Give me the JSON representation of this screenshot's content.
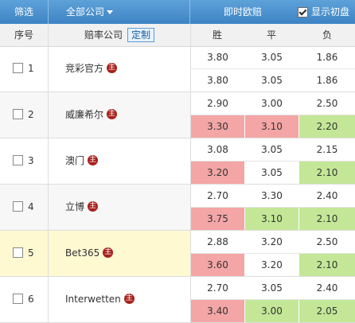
{
  "header": {
    "filter_label": "筛选",
    "company_label": "全部公司",
    "live_label": "即时欧赔",
    "show_initial_label": "显示初盘"
  },
  "subheader": {
    "seq_label": "序号",
    "odds_company_label": "赔率公司",
    "custom_button": "定制",
    "win_label": "胜",
    "draw_label": "平",
    "lose_label": "负"
  },
  "zhu_mark": "主",
  "colors": {
    "up": "#f4a5a5",
    "down": "#c3e796",
    "highlight_row": "#fff9d2"
  },
  "rows": [
    {
      "seq": "1",
      "company": "竞彩官方",
      "initial": [
        "3.80",
        "3.05",
        "1.86"
      ],
      "live": [
        "3.80",
        "3.05",
        "1.86"
      ],
      "live_trend": [
        "",
        "",
        ""
      ]
    },
    {
      "seq": "2",
      "company": "威廉希尔",
      "initial": [
        "2.90",
        "3.00",
        "2.50"
      ],
      "live": [
        "3.30",
        "3.10",
        "2.20"
      ],
      "live_trend": [
        "up",
        "up",
        "down"
      ]
    },
    {
      "seq": "3",
      "company": "澳门",
      "initial": [
        "3.08",
        "3.05",
        "2.15"
      ],
      "live": [
        "3.20",
        "3.05",
        "2.10"
      ],
      "live_trend": [
        "up",
        "",
        "down"
      ]
    },
    {
      "seq": "4",
      "company": "立博",
      "initial": [
        "2.70",
        "3.30",
        "2.40"
      ],
      "live": [
        "3.75",
        "3.10",
        "2.10"
      ],
      "live_trend": [
        "up",
        "down",
        "down"
      ]
    },
    {
      "seq": "5",
      "company": "Bet365",
      "initial": [
        "2.88",
        "3.20",
        "2.50"
      ],
      "live": [
        "3.60",
        "3.20",
        "2.10"
      ],
      "live_trend": [
        "up",
        "",
        "down"
      ]
    },
    {
      "seq": "6",
      "company": "Interwetten",
      "initial": [
        "2.70",
        "3.05",
        "2.40"
      ],
      "live": [
        "3.40",
        "3.00",
        "2.05"
      ],
      "live_trend": [
        "up",
        "down",
        "down"
      ]
    }
  ]
}
